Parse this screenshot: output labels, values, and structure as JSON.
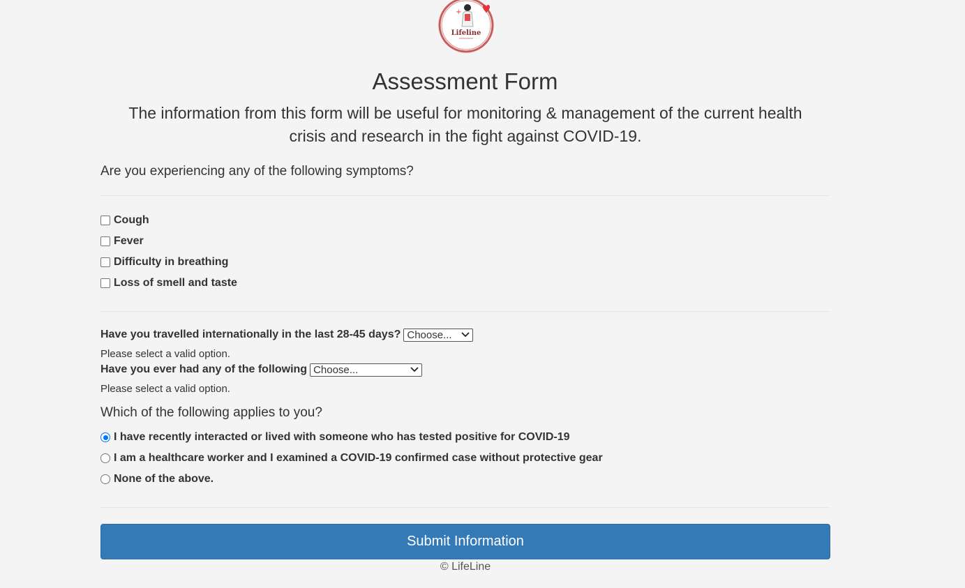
{
  "logo": {
    "text": "Lifeline",
    "icon": "lifeline-logo-icon",
    "ring_color": "#c85a5a",
    "heart_color": "#e0353b"
  },
  "header": {
    "title": "Assessment Form",
    "subtitle": "The information from this form will be useful for monitoring & management of the current health crisis and research in the fight against COVID-19."
  },
  "symptoms": {
    "question": "Are you experiencing any of the following symptoms?",
    "options": [
      {
        "label": "Cough",
        "checked": false
      },
      {
        "label": "Fever",
        "checked": false
      },
      {
        "label": "Difficulty in breathing",
        "checked": false
      },
      {
        "label": "Loss of smell and taste",
        "checked": false
      }
    ]
  },
  "travel": {
    "label": "Have you travelled internationally in the last 28-45 days?",
    "selected": "Choose...",
    "hint": "Please select a valid option."
  },
  "history": {
    "label": "Have you ever had any of the following",
    "selected": "Choose...",
    "hint": "Please select a valid option."
  },
  "applies": {
    "question": "Which of the following applies to you?",
    "options": [
      {
        "label": "I have recently interacted or lived with someone who has tested positive for COVID-19",
        "checked": true
      },
      {
        "label": "I am a healthcare worker and I examined a COVID-19 confirmed case without protective gear",
        "checked": false
      },
      {
        "label": "None of the above.",
        "checked": false
      }
    ]
  },
  "submit": {
    "label": "Submit Information",
    "color": "#337ab7"
  },
  "footer": {
    "text": "© LifeLine"
  }
}
